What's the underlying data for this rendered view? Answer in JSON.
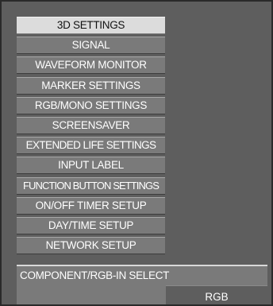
{
  "menu": {
    "items": [
      {
        "label": "3D SETTINGS"
      },
      {
        "label": "SIGNAL"
      },
      {
        "label": "WAVEFORM MONITOR"
      },
      {
        "label": "MARKER SETTINGS"
      },
      {
        "label": "RGB/MONO SETTINGS"
      },
      {
        "label": "SCREENSAVER"
      },
      {
        "label": "EXTENDED LIFE SETTINGS"
      },
      {
        "label": "INPUT LABEL"
      },
      {
        "label": "FUNCTION BUTTON SETTINGS"
      },
      {
        "label": "ON/OFF TIMER SETUP"
      },
      {
        "label": "DAY/TIME SETUP"
      },
      {
        "label": "NETWORK SETUP"
      }
    ]
  },
  "bottom_setting": {
    "label": "COMPONENT/RGB-IN SELECT",
    "value": "RGB"
  }
}
